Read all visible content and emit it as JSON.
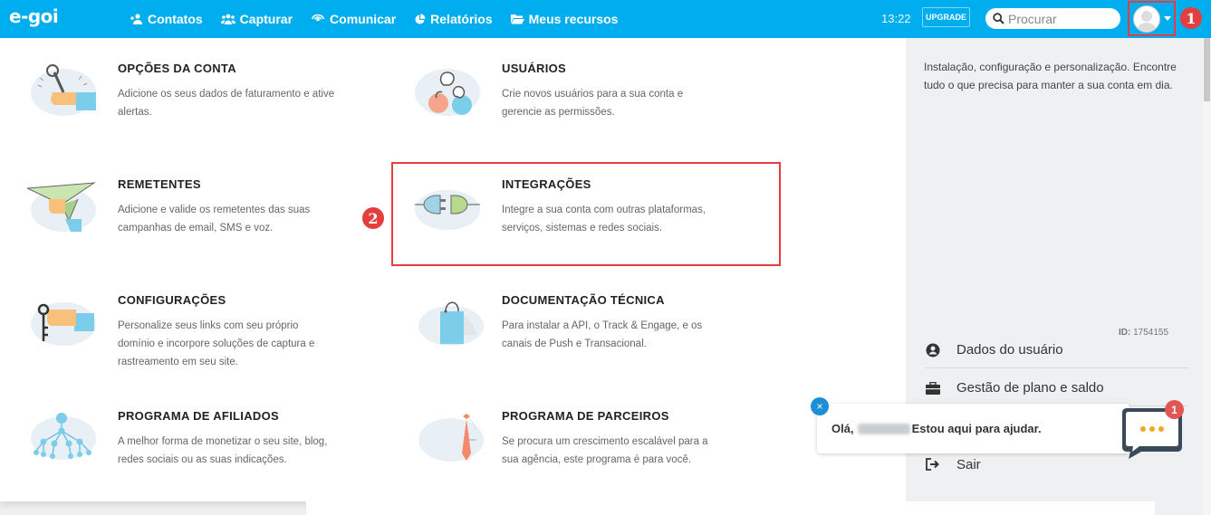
{
  "brand": {
    "logo": "e-goi",
    "accent": "#00aeef",
    "highlight": "#e53e3e"
  },
  "nav": [
    {
      "label": "Contatos",
      "icon": "user-plus-icon"
    },
    {
      "label": "Capturar",
      "icon": "users-icon"
    },
    {
      "label": "Comunicar",
      "icon": "broadcast-icon"
    },
    {
      "label": "Relatórios",
      "icon": "pie-chart-icon"
    },
    {
      "label": "Meus recursos",
      "icon": "folder-open-icon"
    }
  ],
  "header": {
    "time": "13:22",
    "upgrade_label": "UPGRADE",
    "search_placeholder": "Procurar"
  },
  "markers": {
    "one": "1",
    "two": "2"
  },
  "menu": [
    {
      "title": "OPÇÕES DA CONTA",
      "desc": "Adicione os seus dados de faturamento e ative alertas.",
      "icon": "wrench-hand-icon"
    },
    {
      "title": "USUÁRIOS",
      "desc": "Crie novos usuários para a sua conta e gerencie as permissões.",
      "icon": "users-group-icon"
    },
    {
      "title": "REMETENTES",
      "desc": "Adicione e valide os remetentes das suas campanhas de email, SMS e voz.",
      "icon": "paper-plane-icon"
    },
    {
      "title": "INTEGRAÇÕES",
      "desc": "Integre a sua conta com outras plataformas, serviços, sistemas e redes sociais.",
      "icon": "plug-icon"
    },
    {
      "title": "CONFIGURAÇÕES",
      "desc": "Personalize seus links com seu próprio domínio e incorpore soluções de captura e rastreamento em seu site.",
      "icon": "key-icon"
    },
    {
      "title": "DOCUMENTAÇÃO TÉCNICA",
      "desc": "Para instalar a API, o Track & Engage, e os canais de Push e Transacional.",
      "icon": "document-bag-icon"
    },
    {
      "title": "PROGRAMA DE AFILIADOS",
      "desc": "A melhor forma de monetizar o seu site, blog, redes sociais ou as suas indicações.",
      "icon": "network-icon"
    },
    {
      "title": "PROGRAMA DE PARCEIROS",
      "desc": "Se procura um crescimento escalável para a sua agência, este programa é para você.",
      "icon": "tie-icon"
    }
  ],
  "side": {
    "desc": "Instalação, configuração e personalização. Encontre tudo o que precisa para manter a sua conta em dia.",
    "id_label": "ID:",
    "id_value": "1754155",
    "links": [
      {
        "label": "Dados do usuário",
        "icon": "user-circle-icon"
      },
      {
        "label": "Gestão de plano e saldo",
        "icon": "briefcase-icon"
      },
      {
        "label": "Sair",
        "icon": "sign-out-icon"
      }
    ]
  },
  "chat": {
    "greeting_start": "Olá,",
    "greeting_end": "Estou aqui para ajudar.",
    "close": "×",
    "badge": "1"
  }
}
